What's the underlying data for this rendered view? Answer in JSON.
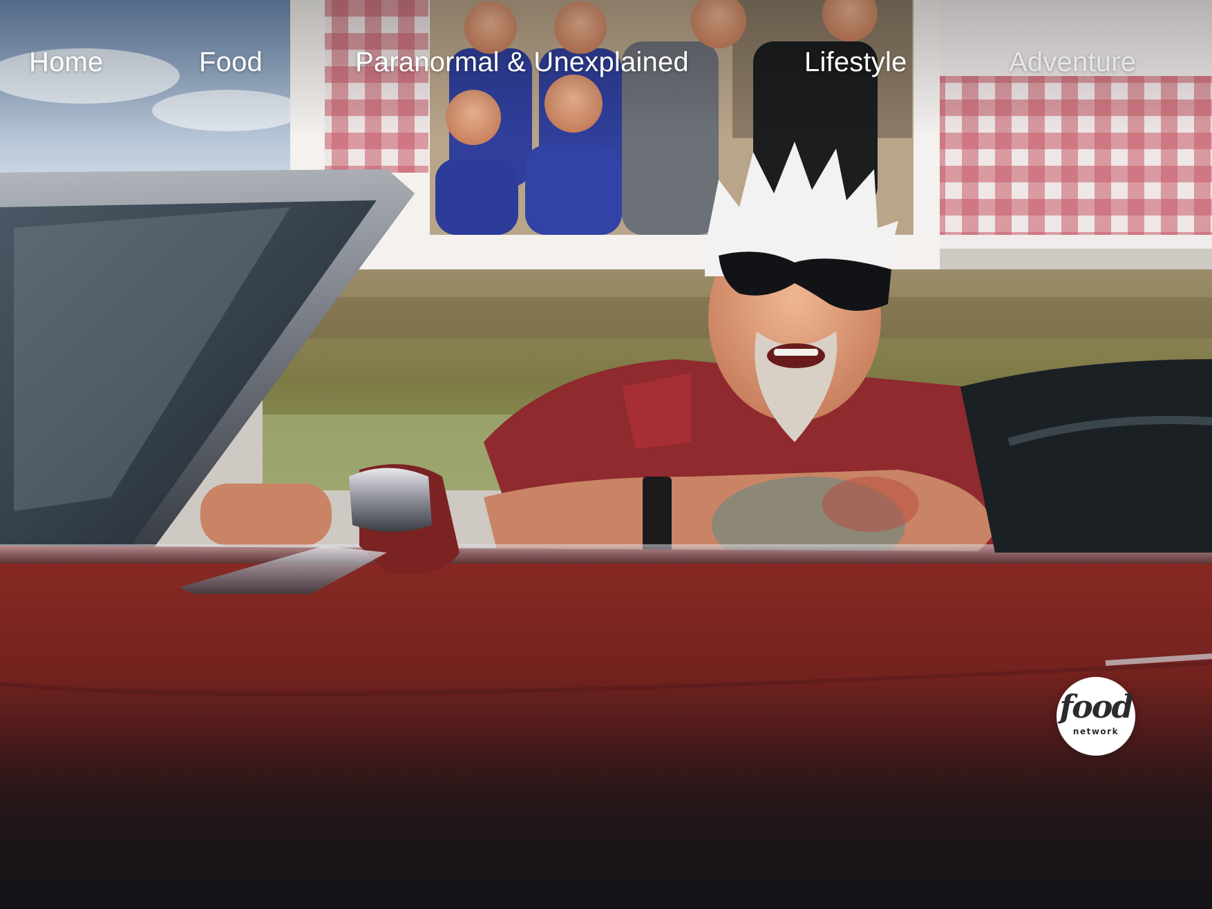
{
  "nav": {
    "items": [
      {
        "label": "Home"
      },
      {
        "label": "Food"
      },
      {
        "label": "Paranormal & Unexplained"
      },
      {
        "label": "Lifestyle"
      },
      {
        "label": "Adventure"
      }
    ]
  },
  "hero": {
    "image_icon": "hero-banner-illustration"
  },
  "brand": {
    "word": "food",
    "sub": "network"
  },
  "colors": {
    "car_red": "#7a221f",
    "background_dark": "#151518",
    "nav_text": "#ffffff"
  }
}
